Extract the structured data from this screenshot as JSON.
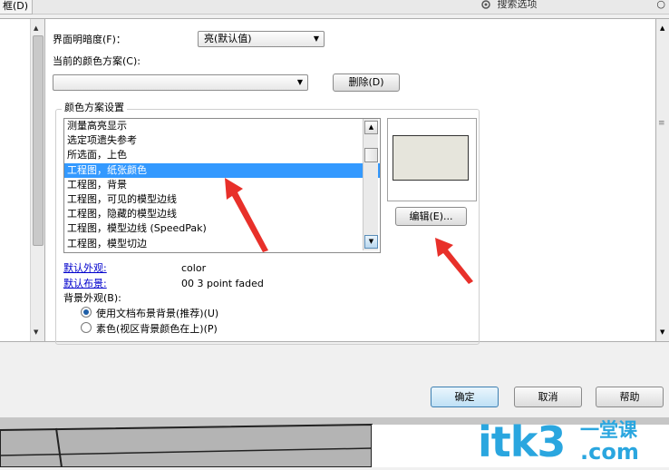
{
  "top_tab": "框(D)",
  "search_placeholder": "搜索选项",
  "brightness": {
    "label": "界面明暗度(F)：",
    "value": "亮(默认值)"
  },
  "scheme": {
    "label": "当前的颜色方案(C):",
    "value": "",
    "delete_label": "删除(D)"
  },
  "scheme_settings": {
    "title": "颜色方案设置",
    "items": [
      "测量高亮显示",
      "选定项遗失参考",
      "所选面，上色",
      "工程图，纸张颜色",
      "工程图，背景",
      "工程图，可见的模型边线",
      "工程图，隐藏的模型边线",
      "工程图，模型边线 (SpeedPak)",
      "工程图，模型切边"
    ],
    "selected_index": 3,
    "preview_color": "#e6e5dc",
    "edit_label": "编辑(E)..."
  },
  "defaults": {
    "appearance_label": "默认外观:",
    "appearance_value": "color",
    "scene_label": "默认布景:",
    "scene_value": "00 3 point faded"
  },
  "background": {
    "label": "背景外观(B):",
    "options": [
      {
        "label": "使用文档布景背景(推荐)(U)",
        "checked": true
      },
      {
        "label": "素色(视区背景颜色在上)(P)",
        "checked": false
      }
    ]
  },
  "footer": {
    "ok": "确定",
    "cancel": "取消",
    "help": "帮助"
  },
  "watermark": {
    "main": "itk3",
    "top": "一堂课",
    "bottom": ".com"
  },
  "colors": {
    "selection": "#3399ff",
    "annotation_arrow": "#e8302a",
    "watermark": "#2aa6df"
  }
}
